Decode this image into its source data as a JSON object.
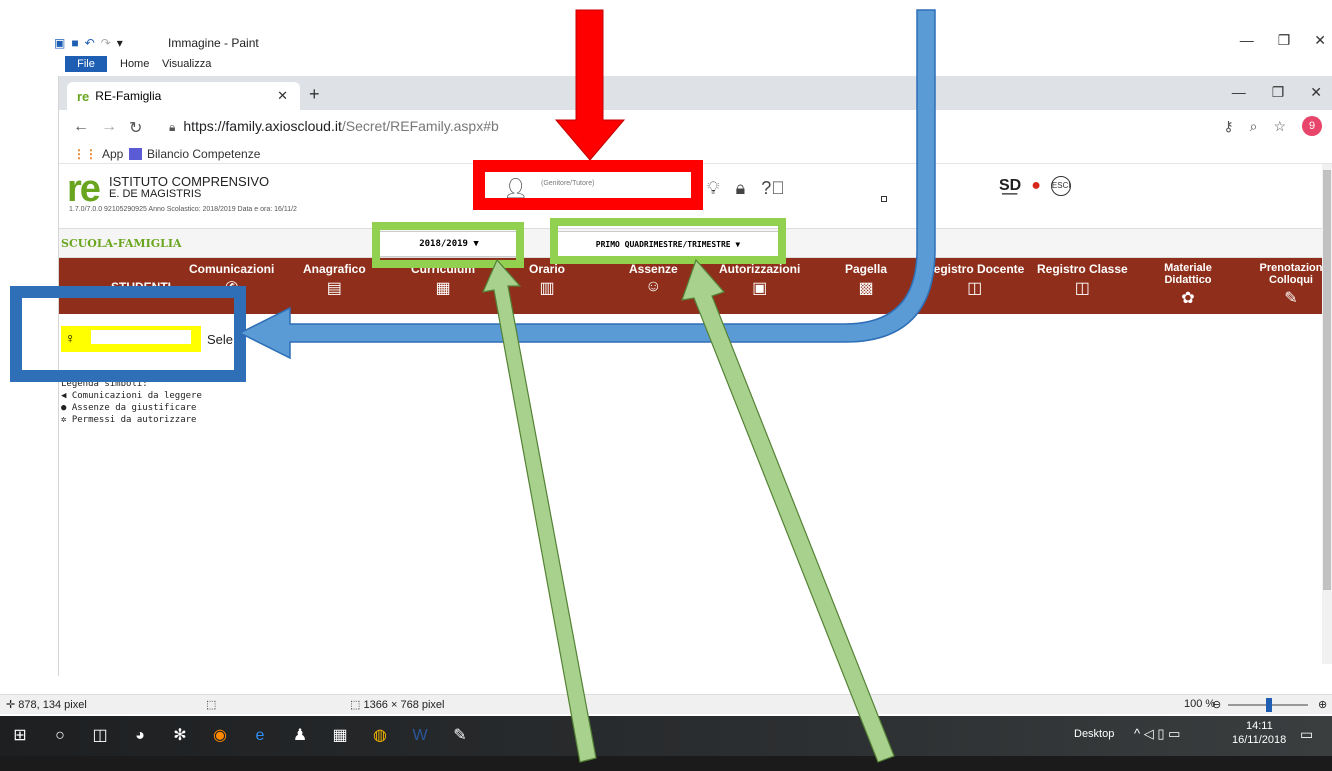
{
  "paint": {
    "title": "Immagine - Paint",
    "tabs": [
      "File",
      "Home",
      "Visualizza"
    ]
  },
  "browser": {
    "tab_title": "RE-Famiglia",
    "url_host": "https://family.axioscloud.it",
    "url_path": "/Secret/REFamily.aspx#b",
    "profile_initial": "9",
    "bookmarks": [
      "App",
      "Bilancio Competenze"
    ]
  },
  "site": {
    "school_title": "ISTITUTO COMPRENSIVO",
    "school_name": "E. DE MAGISTRIS",
    "school_info": "1.7.0/7.0.0   92105290925     Anno Scolastico: 2018/2019   Data e ora: 16/11/2",
    "user_label": "(Genitore/Tutore)",
    "section": "SCUOLA-FAMIGLIA",
    "year_select": "2018/2019 ▼",
    "period_select": "PRIMO QUADRIMESTRE/TRIMESTRE   ▼",
    "students_label": "STUDENTI",
    "nav": [
      {
        "label": "Comunicazioni",
        "icon": "megaphone-icon"
      },
      {
        "label": "Anagrafico",
        "icon": "document-icon"
      },
      {
        "label": "Curriculum",
        "icon": "list-icon"
      },
      {
        "label": "Orario",
        "icon": "calendar-clock-icon"
      },
      {
        "label": "Assenze",
        "icon": "smile-icon"
      },
      {
        "label": "Autorizzazioni",
        "icon": "calendar-check-icon"
      },
      {
        "label": "Pagella",
        "icon": "report-icon"
      },
      {
        "label": "Registro Docente",
        "icon": "book-icon"
      },
      {
        "label": "Registro Classe",
        "icon": "book-icon"
      },
      {
        "label": "Materiale Didattico",
        "icon": "puzzle-icon"
      },
      {
        "label": "Prenotazion Colloqui",
        "icon": "chat-icon"
      }
    ],
    "student_select_text": "Sele",
    "legend": {
      "title": "Legenda simboli:",
      "items": [
        "Comunicazioni da leggere",
        "Assenze da giustificare",
        "Permessi da autorizzare"
      ]
    }
  },
  "status": {
    "cursor_pos": "878, 134 pixel",
    "image_size": "1366 × 768 pixel",
    "zoom": "100 %"
  },
  "taskbar": {
    "desktop": "Desktop",
    "time": "14:11",
    "date": "16/11/2018"
  },
  "colors": {
    "nav_bar": "#8f2f1b",
    "annotation_red": "#ff0000",
    "annotation_green": "#92d050",
    "annotation_blue": "#2e6fb7",
    "highlight_yellow": "#ffff00"
  }
}
